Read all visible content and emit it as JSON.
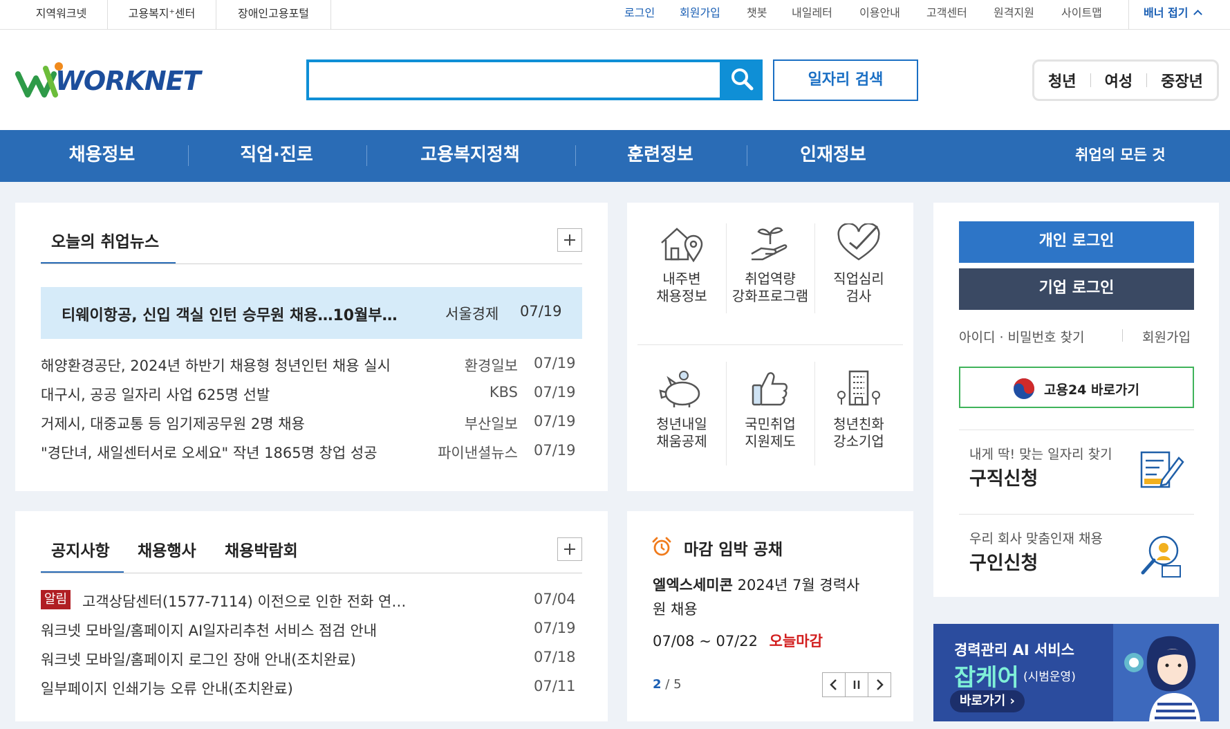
{
  "site_links": [
    "지역워크넷",
    "고용복지⁺센터",
    "장애인고용포털"
  ],
  "util_links": [
    "로그인",
    "회원가입",
    "챗봇",
    "내일레터",
    "이용안내",
    "고객센터",
    "원격지원",
    "사이트맵"
  ],
  "banner_toggle": "배너 접기",
  "logo_text": "WORKNET",
  "search": {
    "placeholder": "",
    "job_search_label": "일자리 검색"
  },
  "group_nav": [
    "청년",
    "여성",
    "중장년"
  ],
  "gnb": {
    "items": [
      "채용정보",
      "직업·진로",
      "고용복지정책",
      "훈련정보",
      "인재정보"
    ],
    "all_label": "취업의 모든 것"
  },
  "news": {
    "tab": "오늘의 취업뉴스",
    "featured": {
      "title": "티웨이항공, 신입 객실 인턴 승무원 채용…10월부…",
      "source": "서울경제",
      "date": "07/19"
    },
    "items": [
      {
        "title": "해양환경공단, 2024년 하반기 채용형 청년인턴 채용 실시",
        "source": "환경일보",
        "date": "07/19"
      },
      {
        "title": "대구시, 공공 일자리 사업 625명 선발",
        "source": "KBS",
        "date": "07/19"
      },
      {
        "title": "거제시, 대중교통 등 임기제공무원 2명 채용",
        "source": "부산일보",
        "date": "07/19"
      },
      {
        "title": "\"경단녀, 새일센터서로 오세요\" 작년 1865명 창업 성공",
        "source": "파이낸셜뉴스",
        "date": "07/19"
      }
    ]
  },
  "quick_links": [
    {
      "label": "내주변\n채용정보",
      "icon": "house-location-icon"
    },
    {
      "label": "취업역량\n강화프로그램",
      "icon": "sprout-hand-icon"
    },
    {
      "label": "직업심리\n검사",
      "icon": "heart-check-icon"
    },
    {
      "label": "청년내일\n채움공제",
      "icon": "piggy-bank-icon"
    },
    {
      "label": "국민취업\n지원제도",
      "icon": "thumbs-up-icon"
    },
    {
      "label": "청년친화\n강소기업",
      "icon": "building-icon"
    }
  ],
  "login": {
    "personal": "개인 로그인",
    "corporate": "기업 로그인",
    "find_id_pw": "아이디 · 비밀번호 찾기",
    "signup": "회원가입",
    "goyong24": "고용24 바로가기",
    "job_seek": {
      "sub": "내게 딱! 맞는 일자리 찾기",
      "title": "구직신청"
    },
    "job_offer": {
      "sub": "우리 회사 맞춤인재 채용",
      "title": "구인신청"
    }
  },
  "notice": {
    "tabs": [
      "공지사항",
      "채용행사",
      "채용박람회"
    ],
    "items": [
      {
        "badge": "알림",
        "title": "고객상담센터(1577-7114) 이전으로 인한 전화 연…",
        "date": "07/04"
      },
      {
        "badge": "",
        "title": "워크넷 모바일/홈페이지 AI일자리추천 서비스 점검 안내",
        "date": "07/19"
      },
      {
        "badge": "",
        "title": "워크넷 모바일/홈페이지 로그인 장애 안내(조치완료)",
        "date": "07/18"
      },
      {
        "badge": "",
        "title": "일부페이지 인쇄기능 오류 안내(조치완료)",
        "date": "07/11"
      }
    ]
  },
  "deadline": {
    "title": "마감 임박 공채",
    "company": "엘엑스세미콘",
    "job_title_line1": "2024년 7월 경력사",
    "job_title_line2": "원 채용",
    "period": "07/08 ~ 07/22",
    "status": "오늘마감",
    "page_current": "2",
    "page_sep": "/",
    "page_total": "5"
  },
  "ai_banner": {
    "line1": "경력관리 AI 서비스",
    "brand": "잡케어",
    "note": "(시범운영)",
    "cta": "바로가기"
  },
  "colors": {
    "brand_blue": "#2a6cb6",
    "search_blue": "#0f8fd6",
    "navy": "#3a4963",
    "alert_red": "#b01e23",
    "highlight": "#d6ebf9"
  }
}
